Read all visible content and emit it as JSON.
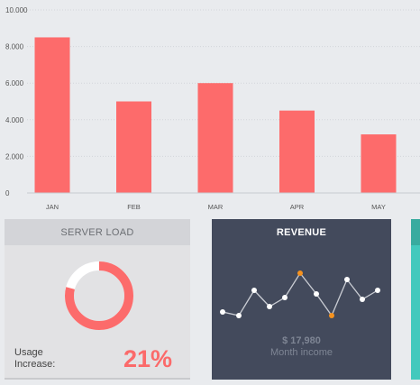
{
  "chart_data": {
    "type": "bar",
    "categories": [
      "JAN",
      "FEB",
      "MAR",
      "APR",
      "MAY"
    ],
    "values": [
      8500,
      5000,
      6000,
      4500,
      3200
    ],
    "ylim": [
      0,
      10000
    ],
    "yticks": [
      "0",
      "2.000",
      "4.000",
      "6.000",
      "8.000",
      "10.000"
    ],
    "ytick_values": [
      0,
      2000,
      4000,
      6000,
      8000,
      10000
    ],
    "grid": true,
    "bar_color": "#fd6b6b"
  },
  "server_load": {
    "title": "SERVER LOAD",
    "usage_label": "Usage Increase:",
    "usage_value": "21%",
    "ring_fill_fraction": 0.79,
    "ring_color": "#fc6b6b"
  },
  "revenue": {
    "title": "REVENUE",
    "amount": "$ 17,980",
    "caption": "Month income",
    "highlight_color": "#f6921e"
  },
  "colors": {
    "background": "#e9ebee",
    "accent_teal": "#43c9bd"
  }
}
